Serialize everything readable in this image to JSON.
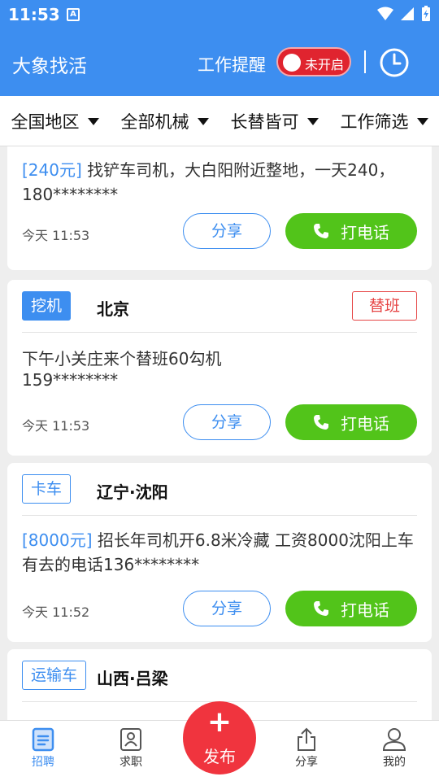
{
  "status": {
    "time": "11:53",
    "notif_letter": "A"
  },
  "appbar": {
    "title": "大象找活",
    "remind_label": "工作提醒",
    "toggle_text": "未开启"
  },
  "filters": [
    "全国地区",
    "全部机械",
    "长替皆可",
    "工作筛选"
  ],
  "cards": [
    {
      "price": "[240元]",
      "desc": "找铲车司机，大白阳附近整地，一天240，180********",
      "time": "今天 11:53",
      "share": "分享",
      "call": "打电话"
    },
    {
      "tag": "挖机",
      "location": "北京",
      "badge": "替班",
      "desc": "下午小关庄来个替班60勾机",
      "desc2": "159********",
      "time": "今天 11:53",
      "share": "分享",
      "call": "打电话"
    },
    {
      "tag": "卡车",
      "location": "辽宁·沈阳",
      "price": "[8000元]",
      "desc": "招长年司机开6.8米冷藏 工资8000沈阳上车 有去的电话136********",
      "time": "今天 11:52",
      "share": "分享",
      "call": "打电话"
    },
    {
      "tag": "运输车",
      "location": "山西·吕梁"
    }
  ],
  "bottom": {
    "tabs": [
      "招聘",
      "求职",
      "分享",
      "我的"
    ],
    "publish": "发布"
  },
  "colors": {
    "primary": "#3d8ef0",
    "call": "#52c41a",
    "publish": "#f0343e",
    "badge": "#e64545"
  }
}
